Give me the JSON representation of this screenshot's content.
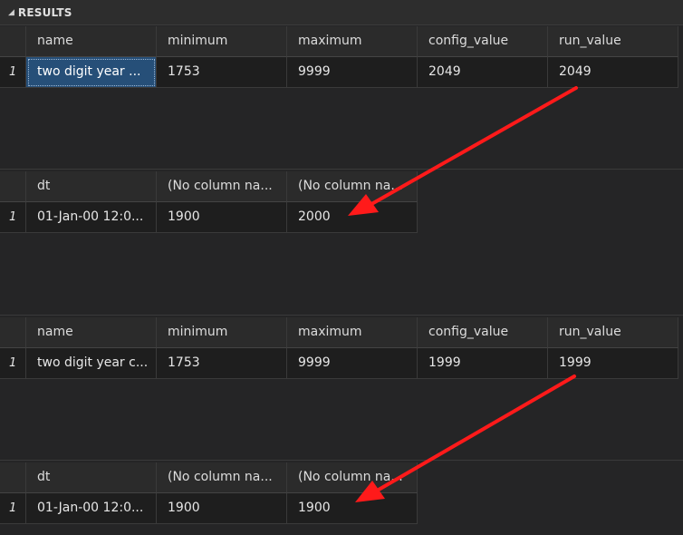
{
  "panel": {
    "title": "RESULTS"
  },
  "grids": [
    {
      "columns": [
        "name",
        "minimum",
        "maximum",
        "config_value",
        "run_value"
      ],
      "rows": [
        {
          "num": "1",
          "cells": [
            "two digit year ...",
            "1753",
            "9999",
            "2049",
            "2049"
          ]
        }
      ]
    },
    {
      "columns": [
        "dt",
        "(No column na...",
        "(No column na..."
      ],
      "rows": [
        {
          "num": "1",
          "cells": [
            "01-Jan-00 12:0...",
            "1900",
            "2000"
          ]
        }
      ]
    },
    {
      "columns": [
        "name",
        "minimum",
        "maximum",
        "config_value",
        "run_value"
      ],
      "rows": [
        {
          "num": "1",
          "cells": [
            "two digit year c...",
            "1753",
            "9999",
            "1999",
            "1999"
          ]
        }
      ]
    },
    {
      "columns": [
        "dt",
        "(No column na...",
        "(No column na..."
      ],
      "rows": [
        {
          "num": "1",
          "cells": [
            "01-Jan-00 12:0...",
            "1900",
            "1900"
          ]
        }
      ]
    }
  ],
  "colors": {
    "annotation_arrow": "#ff1a1a",
    "selection": "#264f78"
  }
}
